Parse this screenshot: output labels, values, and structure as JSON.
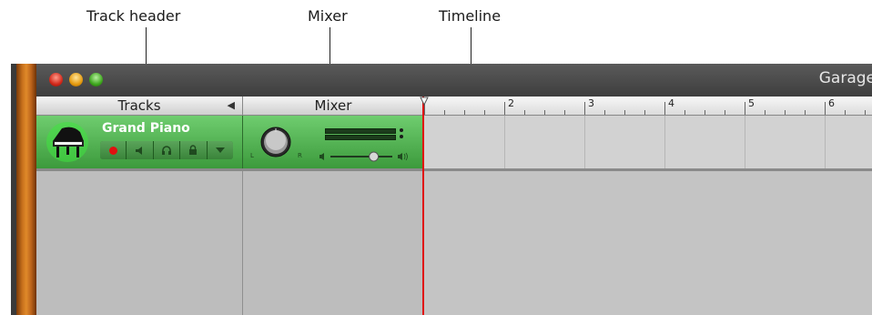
{
  "annotations": {
    "track_header": "Track header",
    "mixer": "Mixer",
    "timeline": "Timeline"
  },
  "window": {
    "title": "Garage"
  },
  "columns": {
    "tracks_label": "Tracks",
    "mixer_label": "Mixer"
  },
  "ruler": {
    "bars": [
      "2",
      "3",
      "4",
      "5",
      "6"
    ]
  },
  "track": {
    "name": "Grand Piano",
    "icon": "grand-piano-icon",
    "controls": [
      "record-icon",
      "mute-icon",
      "headphones-icon",
      "lock-icon",
      "expand-arrow-icon"
    ]
  },
  "mixer": {
    "pan_left": "L",
    "pan_right": "R",
    "volume": 0.7
  },
  "colors": {
    "track_green": "#4fb04f",
    "playhead_red": "#e01010",
    "record_red": "#e01010"
  }
}
